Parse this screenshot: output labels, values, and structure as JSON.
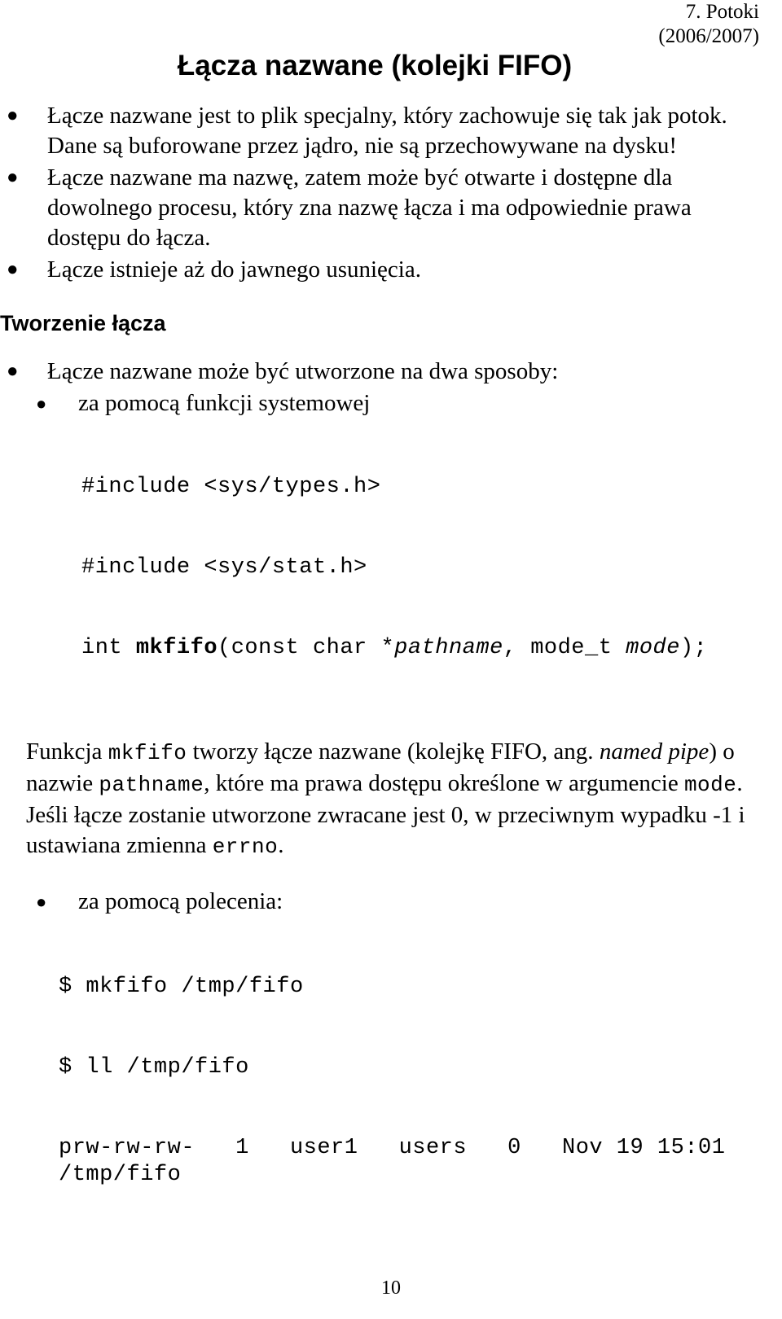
{
  "header": {
    "line1": "7. Potoki",
    "line2": "(2006/2007)"
  },
  "title": "Łącza nazwane  (kolejki FIFO)",
  "intro_bullets": [
    "Łącze nazwane jest to plik specjalny, który zachowuje się tak jak potok. Dane są buforowane przez jądro, nie są przechowywane na dysku!",
    "Łącze nazwane ma nazwę, zatem może być otwarte i dostępne dla dowolnego procesu, który zna nazwę łącza i ma odpowiednie prawa dostępu do łącza.",
    "Łącze istnieje aż do jawnego usunięcia."
  ],
  "section_heading": "Tworzenie łącza",
  "methods_bullet": "Łącze nazwane może być  utworzone na dwa sposoby:",
  "method1_bullet": "za pomocą funkcji systemowej",
  "code": {
    "line1": "#include <sys/types.h>",
    "line2": "#include <sys/stat.h>",
    "line3_pre": "int ",
    "line3_fn": "mkfifo",
    "line3_mid": "(const char *",
    "line3_arg1": "pathname",
    "line3_mid2": ", mode_t ",
    "line3_arg2": "mode",
    "line3_end": ");"
  },
  "description": {
    "s1": "Funkcja ",
    "m1": "mkfifo",
    "s2": " tworzy łącze nazwane (kolejkę FIFO, ang. ",
    "i1": "named pipe",
    "s3": ") o nazwie ",
    "m2": "pathname",
    "s4": ", które ma prawa dostępu określone w argumencie ",
    "m3": "mode",
    "s5": ". Jeśli łącze zostanie utworzone zwracane jest 0, w przeciwnym wypadku -1 i ustawiana zmienna ",
    "m4": "errno",
    "s6": "."
  },
  "method2_bullet": "za pomocą polecenia:",
  "terminal": {
    "line1": "$ mkfifo /tmp/fifo",
    "line2": "$ ll /tmp/fifo",
    "line3": "prw-rw-rw-   1   user1   users   0   Nov 19 15:01 /tmp/fifo"
  },
  "bullet_glyph": "●",
  "page_number": "10"
}
